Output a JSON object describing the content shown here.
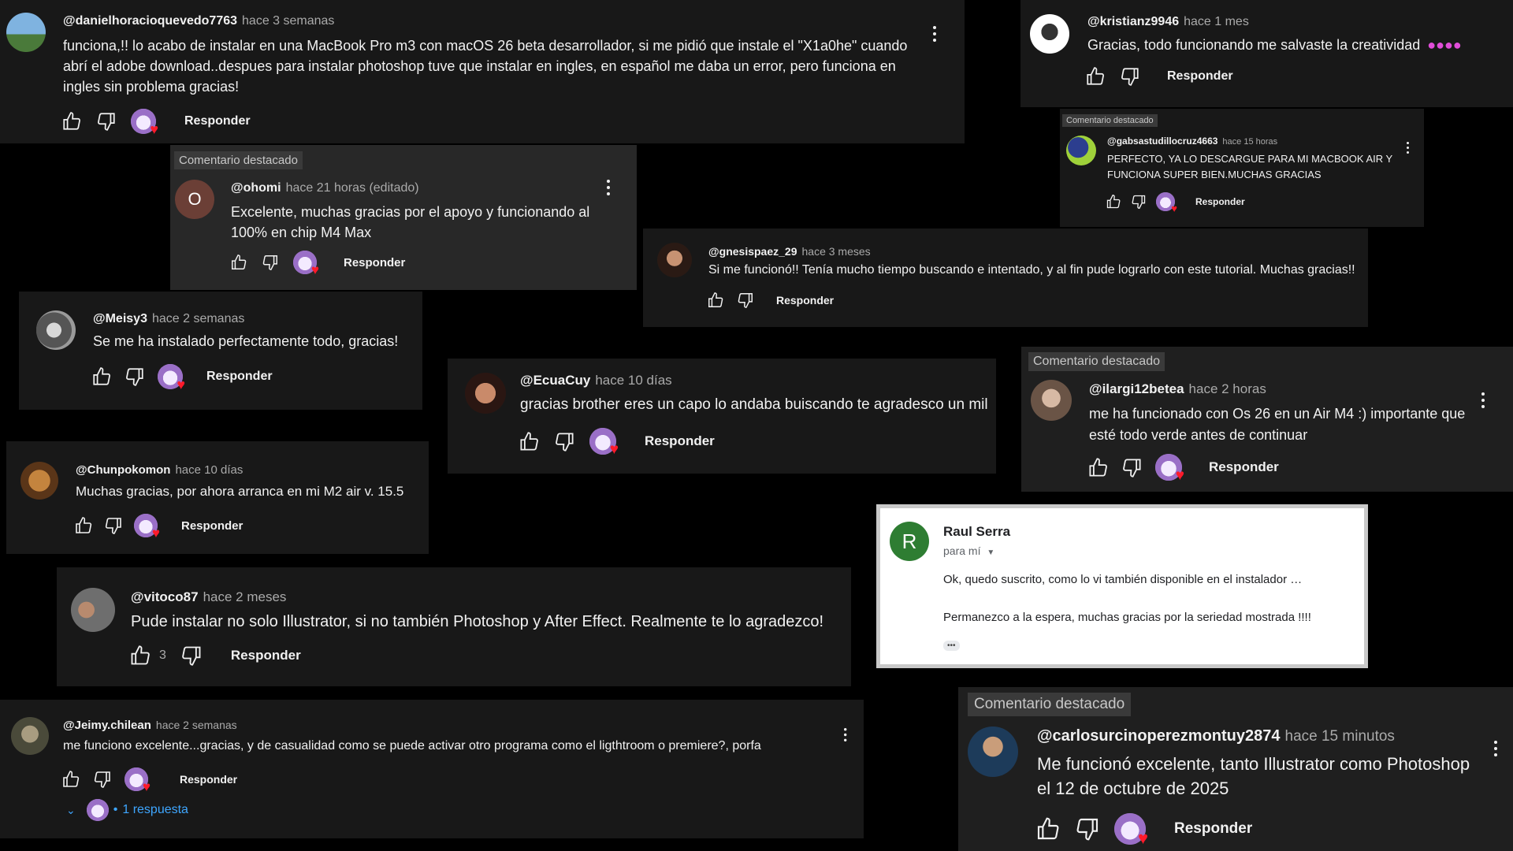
{
  "common": {
    "reply": "Responder",
    "pinned": "Comentario destacado"
  },
  "colors": {
    "card_bg": "#181818",
    "page_bg": "#000000",
    "link_blue": "#3ea6ff",
    "heart": "#ff1a2a"
  },
  "comments": [
    {
      "user": "@danielhoraciоquevedo7763",
      "time": "hace 3 semanas",
      "text": "funciona,!! lo acabo de instalar en una MacBook Pro m3 con macOS 26 beta desarrollador, si me pidió que instale el \"X1a0he\" cuando abrí el adobe download..despues para instalar photoshop tuve que instalar en ingles, en español me daba un error, pero funciona en ingles sin problema gracias!"
    },
    {
      "user": "@kristianz9946",
      "time": "hace 1 mes",
      "text": "Gracias, todo funcionando me salvaste la creatividad"
    },
    {
      "user": "@gabsastudillocruz4663",
      "time": "hace 15 horas",
      "text": "PERFECTO, YA LO DESCARGUE PARA MI MACBOOK AIR Y FUNCIONA SUPER BIEN.MUCHAS GRACIAS"
    },
    {
      "user": "@ohomi",
      "time": "hace 21 horas (editado)",
      "avatar_letter": "O",
      "text": "Excelente, muchas gracias por el apoyo y funcionando al 100% en chip M4 Max"
    },
    {
      "user": "@gnesispaez_29",
      "time": "hace 3 meses",
      "text": "Si me funcionó!! Tenía mucho tiempo buscando e intentado, y al fin pude lograrlo con este tutorial. Muchas gracias!!"
    },
    {
      "user": "@Meisy3",
      "time": "hace 2 semanas",
      "text": "Se me ha instalado perfectamente todo, gracias!"
    },
    {
      "user": "@EcuaCuy",
      "time": "hace 10 días",
      "text": "gracias brother eres un capo lo andaba buiscando te agradesco un mil"
    },
    {
      "user": "@ilargi12betea",
      "time": "hace 2 horas",
      "text": "me ha funcionado con Os 26 en un Air M4 :) importante que esté todo verde antes de continuar"
    },
    {
      "user": "@Chunpokomon",
      "time": "hace 10 días",
      "text": "Muchas gracias, por ahora arranca en mi M2 air v. 15.5"
    },
    {
      "user": "@vitoco87",
      "time": "hace 2 meses",
      "likes": "3",
      "text": "Pude instalar no solo Illustrator, si no también Photoshop y After Effect. Realmente te lo agradezco!"
    },
    {
      "user": "@Jeimy.chilean",
      "time": "hace 2 semanas",
      "text": "me funciono excelente...gracias, y de casualidad como se puede activar otro programa como el ligthtroom o premiere?, porfa",
      "replies": "1 respuesta",
      "dot": "•"
    },
    {
      "user": "@carlosurcinoperezmontuy2874",
      "time": "hace 15 minutos",
      "text": "Me funcionó excelente, tanto Illustrator como Photoshop el 12 de octubre de 2025"
    }
  ],
  "email": {
    "avatar_letter": "R",
    "sender": "Raul Serra",
    "to": "para mí",
    "line1": "Ok, quedo suscrito, como lo vi también disponible en el instalador …",
    "line2": "Permanezco a la espera, muchas gracias por la seriedad mostrada !!!!",
    "more": "•••"
  }
}
